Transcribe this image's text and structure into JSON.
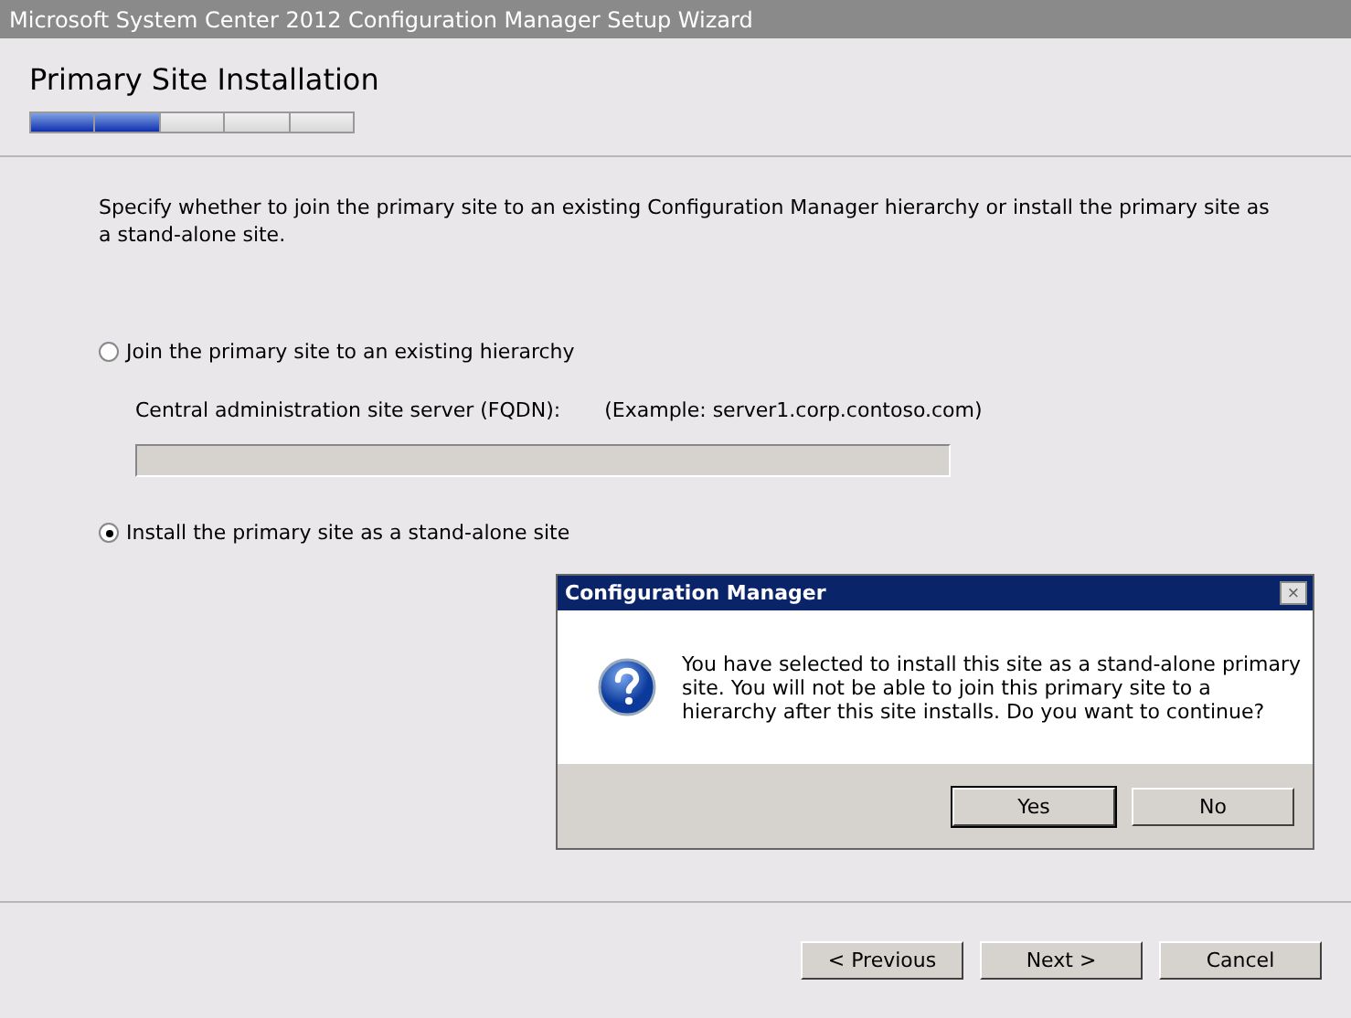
{
  "window": {
    "title": "Microsoft System Center 2012 Configuration Manager Setup Wizard"
  },
  "page": {
    "title": "Primary Site Installation",
    "steps": [
      {
        "done": true
      },
      {
        "done": true
      },
      {
        "done": false
      },
      {
        "done": false
      },
      {
        "done": false
      }
    ]
  },
  "intro": "Specify whether to join the primary site to an existing Configuration Manager hierarchy or install the primary site as a stand-alone site.",
  "options": [
    {
      "label": "Join the primary site to an existing hierarchy",
      "selected": false
    },
    {
      "label": "Install the primary site as a stand-alone site",
      "selected": true
    }
  ],
  "server_field": {
    "label": "Central administration site server (FQDN):",
    "example": "(Example: server1.corp.contoso.com)",
    "disabled": true
  },
  "buttons": [
    "< Previous",
    "Next >",
    "Cancel"
  ],
  "dialog": {
    "title": "Configuration Manager",
    "close": "×",
    "message": "You have selected to install this site as a stand-alone primary site. You will not be able to join this primary site to a hierarchy after this site installs. Do you want to continue?",
    "buttons": [
      {
        "label": "Yes",
        "default": true
      },
      {
        "label": "No",
        "default": false
      }
    ]
  }
}
